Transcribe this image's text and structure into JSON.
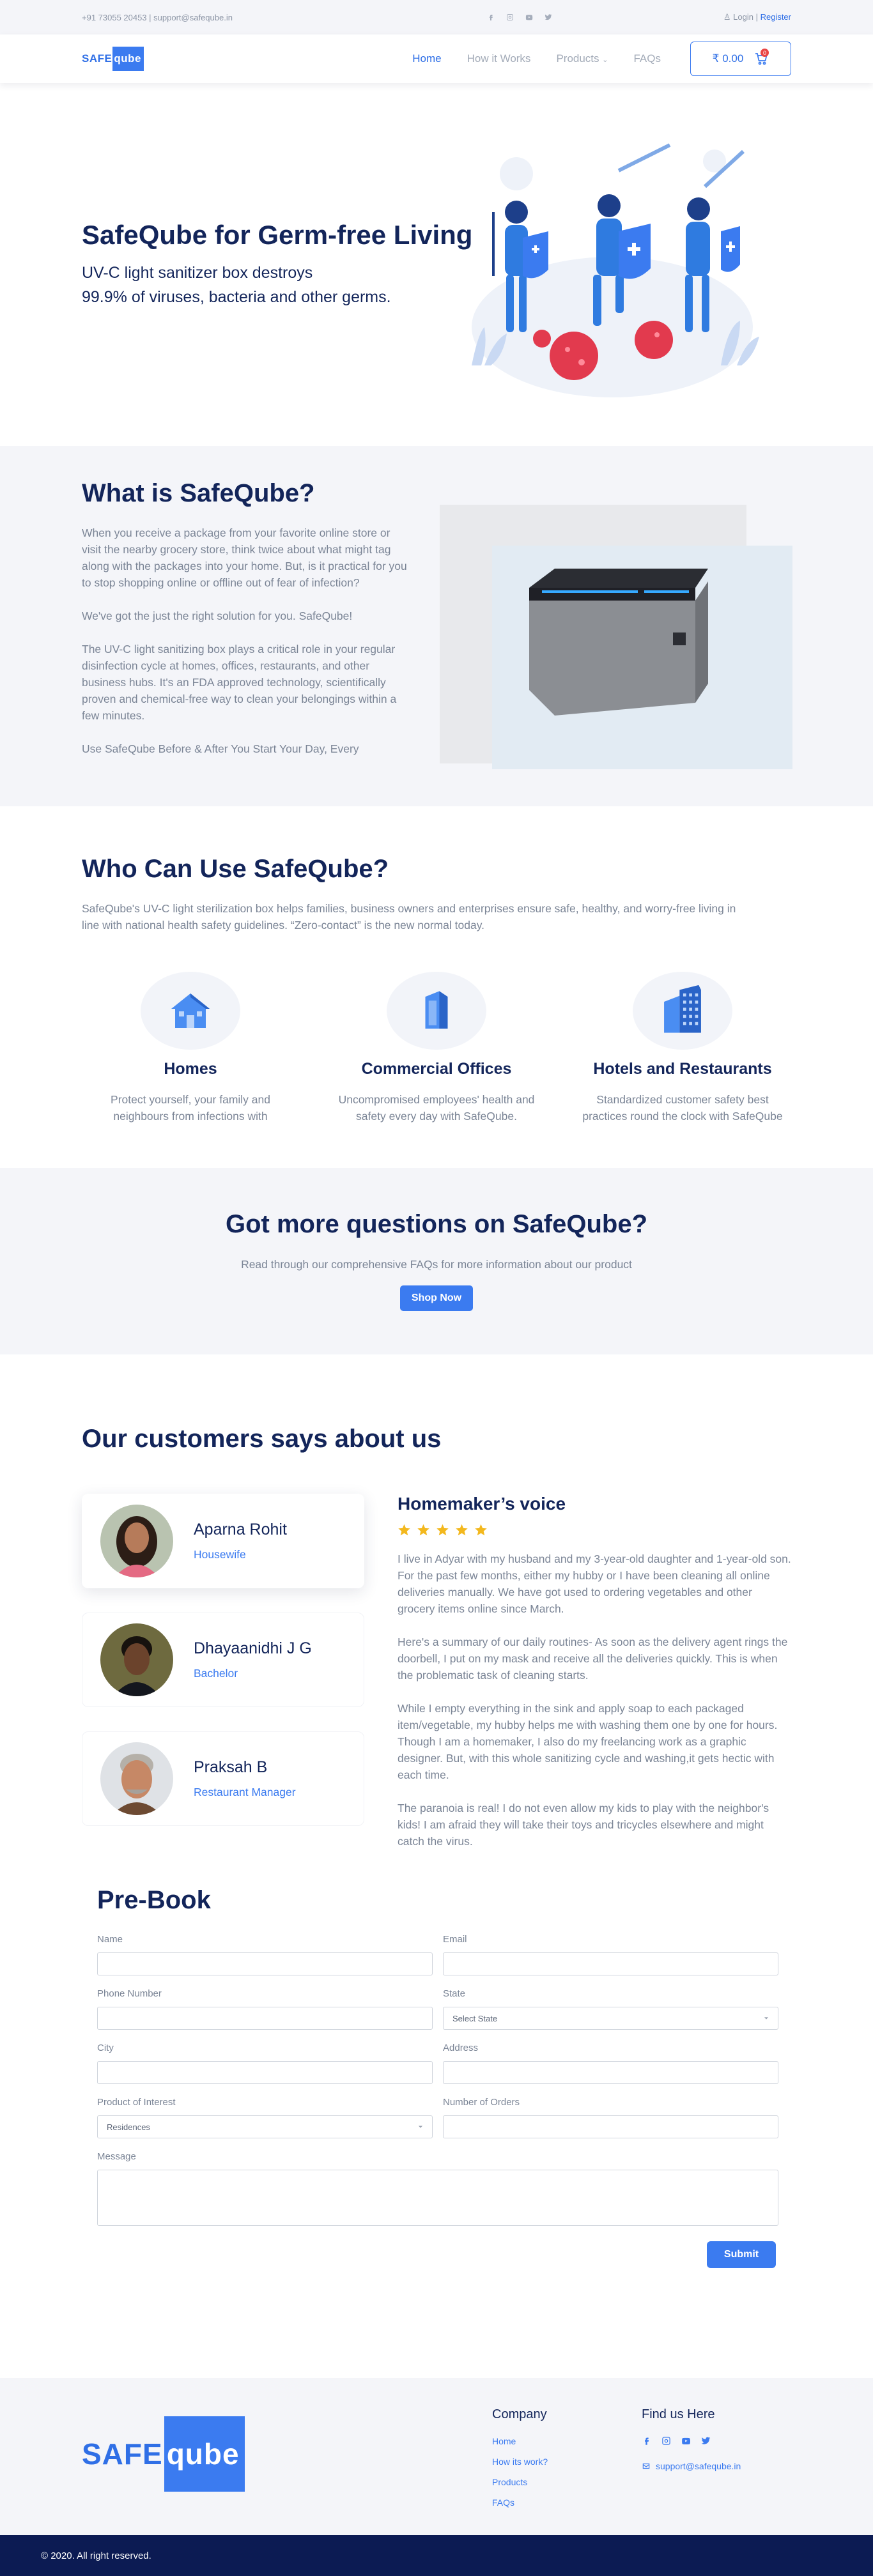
{
  "topbar": {
    "contact": "+91 73055 20453 | support@safeqube.in",
    "login": "Login",
    "separator": "|",
    "register": "Register",
    "social_icons": [
      "facebook-icon",
      "instagram-icon",
      "youtube-icon",
      "twitter-icon"
    ]
  },
  "nav": {
    "logo_left": "SAFE",
    "logo_right": "qube",
    "menu": [
      "Home",
      "How it Works",
      "Products",
      "FAQs"
    ],
    "cart_amount": "₹ 0.00",
    "cart_count": "0"
  },
  "hero": {
    "title": "SafeQube for Germ-free Living",
    "line1": "UV-C light sanitizer box destroys",
    "line2": "99.9% of viruses, bacteria and other germs."
  },
  "what": {
    "title": "What is SafeQube?",
    "paragraphs": [
      "When you receive a package from your favorite online store or visit the nearby grocery store, think twice about what might tag along with the packages into your home. But, is it practical for you to stop shopping online or offline out of fear of infection?",
      "We've got the just the right solution for you. SafeQube!",
      "The UV-C light sanitizing box plays a critical role in your regular disinfection cycle at homes, offices, restaurants, and other business hubs. It's an FDA approved technology, scientifically proven and chemical-free way to clean your belongings within a few minutes.",
      "Use SafeQube Before & After You Start Your Day, Every"
    ]
  },
  "who": {
    "title": "Who Can Use SafeQube?",
    "lead": "SafeQube's UV-C light sterilization box helps families, business owners and enterprises ensure safe, healthy, and worry-free living in line with national health safety guidelines. “Zero-contact” is the new normal today.",
    "cards": [
      {
        "title": "Homes",
        "text": "Protect yourself, your family and neighbours from infections with"
      },
      {
        "title": "Commercial Offices",
        "text": "Uncompromised employees' health and safety every day with SafeQube."
      },
      {
        "title": "Hotels and Restaurants",
        "text": "Standardized customer safety best practices round the clock with SafeQube"
      }
    ]
  },
  "faq": {
    "title": "Got more questions on SafeQube?",
    "text": "Read through our comprehensive FAQs for more information about our product",
    "button": "Shop Now"
  },
  "testimonials": {
    "title": "Our customers says about us",
    "people": [
      {
        "name": "Aparna Rohit",
        "role": "Housewife"
      },
      {
        "name": "Dhayaanidhi J G",
        "role": "Bachelor"
      },
      {
        "name": "Praksah B",
        "role": "Restaurant Manager"
      }
    ],
    "quote_title": "Homemaker’s voice",
    "rating": 5,
    "quote_paragraphs": [
      "I live in Adyar with my husband and my 3-year-old daughter and 1-year-old son.\nFor the past few months, either my hubby or I have been cleaning all online deliveries manually. We have got used to ordering vegetables and other grocery items online since March.",
      "Here's a summary of our daily routines- As soon as the delivery agent rings the doorbell, I put on my mask and receive all the deliveries quickly. This is when the problematic task of cleaning starts.",
      "While I empty everything in the sink and apply soap to each packaged item/vegetable, my hubby helps me with washing them one by one for hours. Though I am a homemaker, I also do my freelancing work as a graphic designer. But, with this whole sanitizing cycle and washing,it gets hectic with each time.",
      " The paranoia is real! I do not even allow my kids to play with the neighbor's kids! I am afraid they will take their toys and tricycles elsewhere and might catch the virus."
    ]
  },
  "prebook": {
    "title": "Pre-Book",
    "fields": {
      "name": {
        "label": "Name",
        "value": ""
      },
      "email": {
        "label": "Email",
        "value": ""
      },
      "phone": {
        "label": "Phone Number",
        "value": ""
      },
      "state": {
        "label": "State",
        "value": "Select State"
      },
      "city": {
        "label": "City",
        "value": ""
      },
      "address": {
        "label": "Address",
        "value": ""
      },
      "product": {
        "label": "Product of Interest",
        "value": "Residences"
      },
      "orders": {
        "label": "Number of Orders",
        "value": ""
      },
      "message": {
        "label": "Message",
        "value": ""
      }
    },
    "submit": "Submit"
  },
  "footer": {
    "logo_left": "SAFE",
    "logo_right": "qube",
    "company_title": "Company",
    "company_links": [
      "Home",
      "How its work?",
      "Products",
      "FAQs"
    ],
    "find_title": "Find us Here",
    "find_icons": [
      "facebook-icon",
      "instagram-icon",
      "youtube-icon",
      "twitter-icon"
    ],
    "email": "support@safeqube.in",
    "copyright": "© 2020. All right reserved."
  },
  "colors": {
    "accent": "#3b7bf0",
    "heading": "#13255a",
    "muted": "#7b8596",
    "band": "#f4f5f9",
    "footer_dark": "#0c1b53",
    "star": "#f3b81d"
  }
}
